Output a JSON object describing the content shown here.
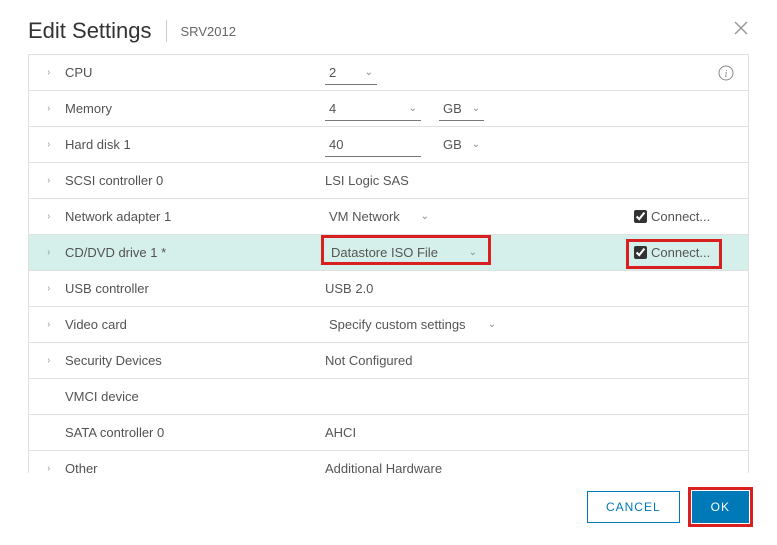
{
  "header": {
    "title": "Edit Settings",
    "subtitle": "SRV2012"
  },
  "rows": {
    "cpu": {
      "label": "CPU",
      "value": "2"
    },
    "memory": {
      "label": "Memory",
      "value": "4",
      "unit": "GB"
    },
    "hd": {
      "label": "Hard disk 1",
      "value": "40",
      "unit": "GB"
    },
    "scsi": {
      "label": "SCSI controller 0",
      "value": "LSI Logic SAS"
    },
    "net": {
      "label": "Network adapter 1",
      "value": "VM Network",
      "connect": "Connect..."
    },
    "cd": {
      "label": "CD/DVD drive 1 *",
      "value": "Datastore ISO File",
      "connect": "Connect..."
    },
    "usb": {
      "label": "USB controller",
      "value": "USB 2.0"
    },
    "video": {
      "label": "Video card",
      "value": "Specify custom settings"
    },
    "sec": {
      "label": "Security Devices",
      "value": "Not Configured"
    },
    "vmci": {
      "label": "VMCI device"
    },
    "sata": {
      "label": "SATA controller 0",
      "value": "AHCI"
    },
    "other": {
      "label": "Other",
      "value": "Additional Hardware"
    }
  },
  "footer": {
    "cancel": "CANCEL",
    "ok": "OK"
  },
  "colors": {
    "primary": "#0079b8",
    "highlight_row": "#d5f0eb",
    "annotation": "#d82020"
  }
}
